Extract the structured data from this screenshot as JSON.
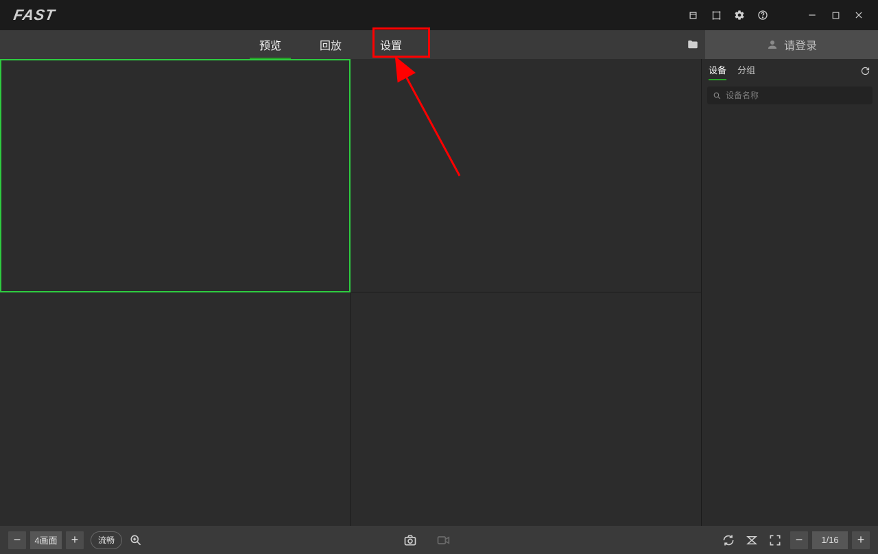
{
  "title": {
    "logo_text": "FAST"
  },
  "tabs": {
    "preview": "预览",
    "playback": "回放",
    "settings": "设置"
  },
  "login": {
    "label": "请登录"
  },
  "sidepanel": {
    "tab_device": "设备",
    "tab_group": "分组",
    "search_placeholder": "设备名称"
  },
  "bottombar": {
    "layout_label": "4画面",
    "stream_label": "流畅",
    "page_label": "1/16"
  },
  "icons": {
    "minus": "−",
    "plus": "+"
  }
}
